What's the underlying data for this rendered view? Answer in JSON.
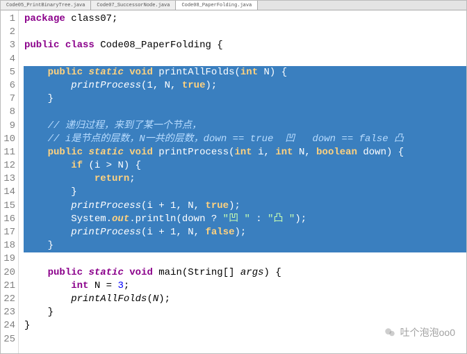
{
  "tabs": [
    {
      "label": "Code05_PrintBinaryTree.java",
      "active": false
    },
    {
      "label": "Code07_SuccessorNode.java",
      "active": false
    },
    {
      "label": "Code08_PaperFolding.java",
      "active": true
    }
  ],
  "gutter": {
    "start": 1,
    "end": 25
  },
  "code": {
    "lines": [
      {
        "hl": false,
        "tokens": [
          [
            "kw",
            "package"
          ],
          [
            "pl",
            " class07;"
          ]
        ]
      },
      {
        "hl": false,
        "tokens": []
      },
      {
        "hl": false,
        "tokens": [
          [
            "kw",
            "public"
          ],
          [
            "pl",
            " "
          ],
          [
            "kw",
            "class"
          ],
          [
            "pl",
            " Code08_PaperFolding {"
          ]
        ]
      },
      {
        "hl": false,
        "tokens": []
      },
      {
        "hl": true,
        "tokens": [
          [
            "pl",
            "    "
          ],
          [
            "kw",
            "public"
          ],
          [
            "pl",
            " "
          ],
          [
            "kw2",
            "static"
          ],
          [
            "pl",
            " "
          ],
          [
            "kw",
            "void"
          ],
          [
            "pl",
            " printAllFolds("
          ],
          [
            "kw",
            "int"
          ],
          [
            "pl",
            " N) {"
          ]
        ]
      },
      {
        "hl": true,
        "tokens": [
          [
            "pl",
            "        "
          ],
          [
            "fn-call",
            "printProcess"
          ],
          [
            "pl",
            "(1, N, "
          ],
          [
            "kw",
            "true"
          ],
          [
            "pl",
            ");"
          ]
        ]
      },
      {
        "hl": true,
        "tokens": [
          [
            "pl",
            "    }"
          ]
        ]
      },
      {
        "hl": true,
        "tokens": []
      },
      {
        "hl": true,
        "tokens": [
          [
            "pl",
            "    "
          ],
          [
            "cmt",
            "// 递归过程，来到了某一个节点，"
          ]
        ]
      },
      {
        "hl": true,
        "tokens": [
          [
            "pl",
            "    "
          ],
          [
            "cmt",
            "// i是节点的层数，N一共的层数，down == true  凹   down == false 凸"
          ]
        ]
      },
      {
        "hl": true,
        "tokens": [
          [
            "pl",
            "    "
          ],
          [
            "kw",
            "public"
          ],
          [
            "pl",
            " "
          ],
          [
            "kw2",
            "static"
          ],
          [
            "pl",
            " "
          ],
          [
            "kw",
            "void"
          ],
          [
            "pl",
            " printProcess("
          ],
          [
            "kw",
            "int"
          ],
          [
            "pl",
            " i, "
          ],
          [
            "kw",
            "int"
          ],
          [
            "pl",
            " N, "
          ],
          [
            "kw",
            "boolean"
          ],
          [
            "pl",
            " down) {"
          ]
        ]
      },
      {
        "hl": true,
        "tokens": [
          [
            "pl",
            "        "
          ],
          [
            "kw",
            "if"
          ],
          [
            "pl",
            " (i > N) {"
          ]
        ]
      },
      {
        "hl": true,
        "tokens": [
          [
            "pl",
            "            "
          ],
          [
            "kw",
            "return"
          ],
          [
            "pl",
            ";"
          ]
        ]
      },
      {
        "hl": true,
        "tokens": [
          [
            "pl",
            "        }"
          ]
        ]
      },
      {
        "hl": true,
        "tokens": [
          [
            "pl",
            "        "
          ],
          [
            "fn-call",
            "printProcess"
          ],
          [
            "pl",
            "(i + 1, N, "
          ],
          [
            "kw",
            "true"
          ],
          [
            "pl",
            ");"
          ]
        ]
      },
      {
        "hl": true,
        "tokens": [
          [
            "pl",
            "        System."
          ],
          [
            "kw2",
            "out"
          ],
          [
            "pl",
            ".println(down ? "
          ],
          [
            "str",
            "\"凹 \""
          ],
          [
            "pl",
            " : "
          ],
          [
            "str",
            "\"凸 \""
          ],
          [
            "pl",
            ");"
          ]
        ]
      },
      {
        "hl": true,
        "tokens": [
          [
            "pl",
            "        "
          ],
          [
            "fn-call",
            "printProcess"
          ],
          [
            "pl",
            "(i + 1, N, "
          ],
          [
            "kw",
            "false"
          ],
          [
            "pl",
            ");"
          ]
        ]
      },
      {
        "hl": true,
        "tokens": [
          [
            "pl",
            "    }"
          ]
        ]
      },
      {
        "hl": false,
        "tokens": []
      },
      {
        "hl": false,
        "tokens": [
          [
            "pl",
            "    "
          ],
          [
            "kw",
            "public"
          ],
          [
            "pl",
            " "
          ],
          [
            "kw2",
            "static"
          ],
          [
            "pl",
            " "
          ],
          [
            "kw",
            "void"
          ],
          [
            "pl",
            " main(String[] "
          ],
          [
            "param",
            "args"
          ],
          [
            "pl",
            ") {"
          ]
        ]
      },
      {
        "hl": false,
        "tokens": [
          [
            "pl",
            "        "
          ],
          [
            "kw",
            "int"
          ],
          [
            "pl",
            " N = "
          ],
          [
            "num",
            "3"
          ],
          [
            "pl",
            ";"
          ]
        ]
      },
      {
        "hl": false,
        "tokens": [
          [
            "pl",
            "        "
          ],
          [
            "fn-call",
            "printAllFolds"
          ],
          [
            "pl",
            "("
          ],
          [
            "param",
            "N"
          ],
          [
            "pl",
            ");"
          ]
        ]
      },
      {
        "hl": false,
        "tokens": [
          [
            "pl",
            "    }"
          ]
        ]
      },
      {
        "hl": false,
        "tokens": [
          [
            "pl",
            "}"
          ]
        ]
      },
      {
        "hl": false,
        "tokens": []
      }
    ]
  },
  "watermark": {
    "text": "吐个泡泡oo0"
  }
}
